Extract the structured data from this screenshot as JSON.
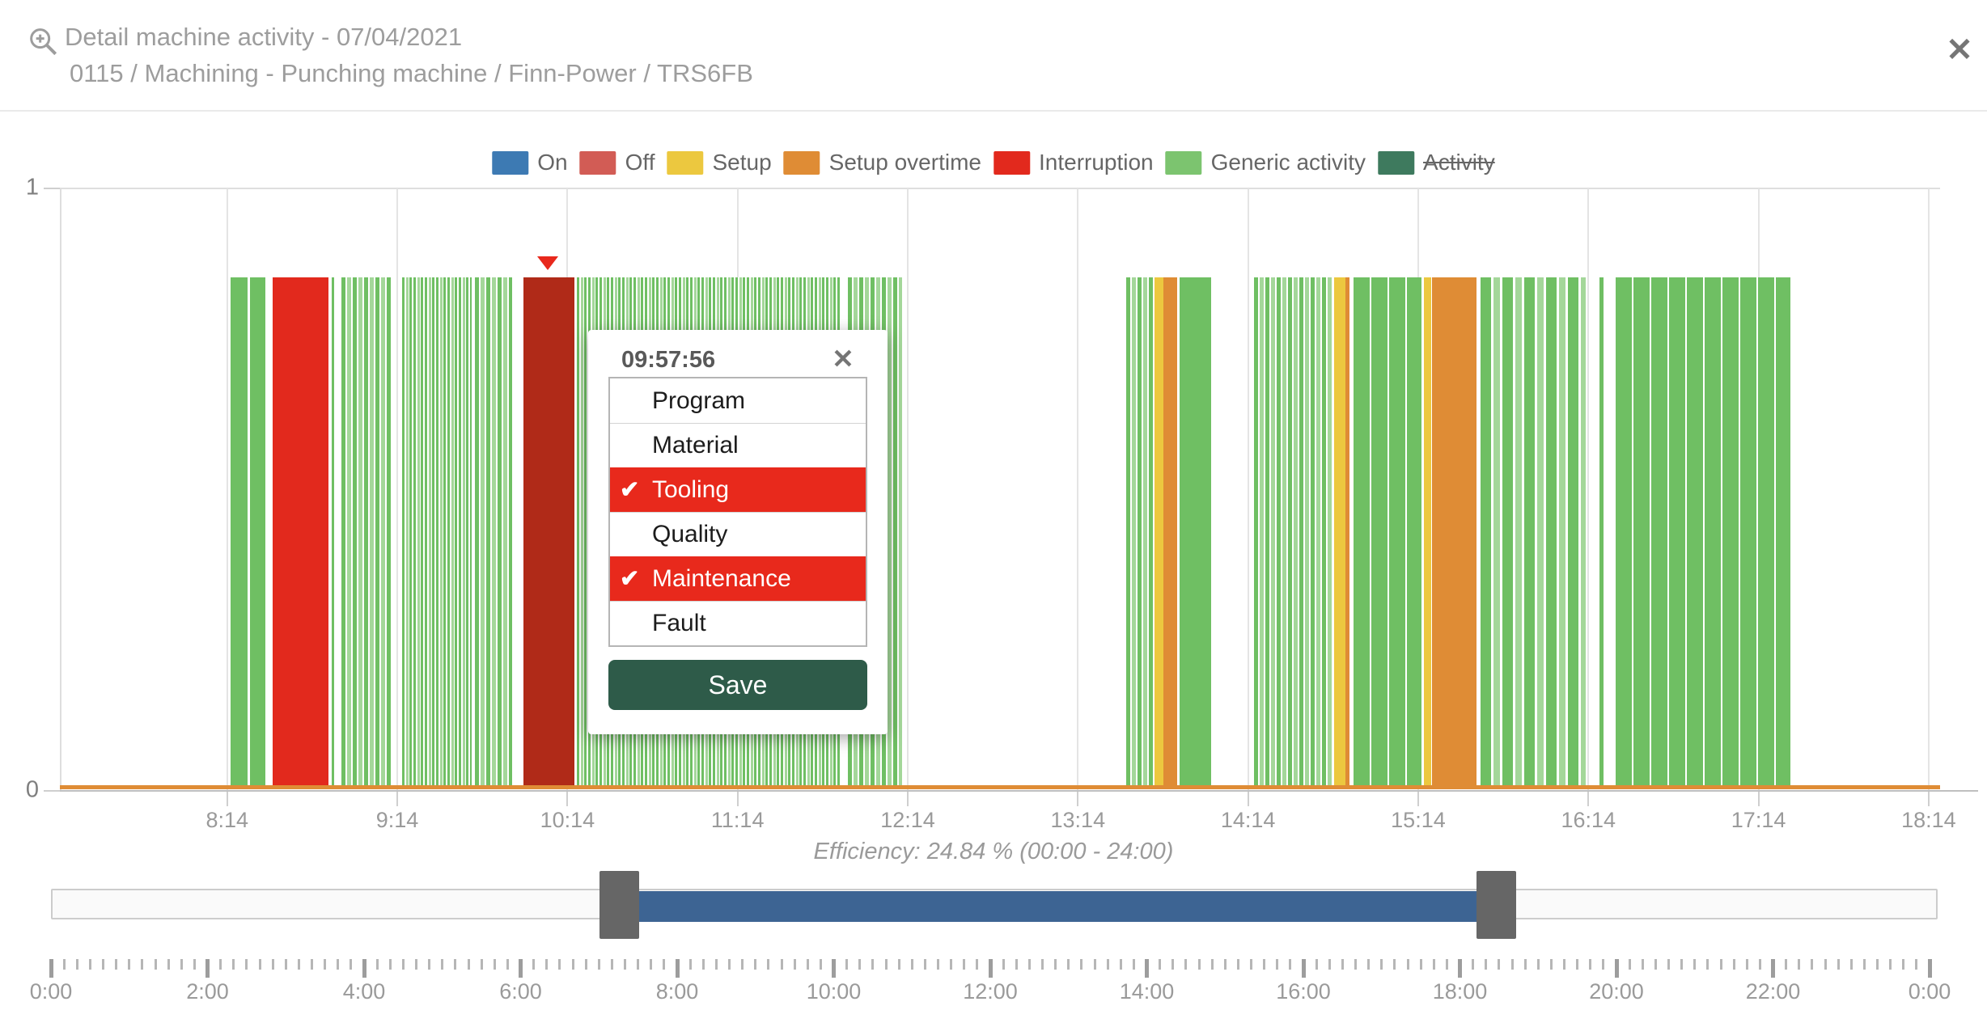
{
  "header": {
    "title": "Detail machine activity - 07/04/2021",
    "subtitle": "0115 / Machining - Punching machine / Finn-Power / TRS6FB"
  },
  "close_button": "✕",
  "legend": [
    {
      "label": "On",
      "color": "#3d7ab3",
      "struck": false
    },
    {
      "label": "Off",
      "color": "#d25c55",
      "struck": false
    },
    {
      "label": "Setup",
      "color": "#ecc83f",
      "struck": false
    },
    {
      "label": "Setup overtime",
      "color": "#df8c35",
      "struck": false
    },
    {
      "label": "Interruption",
      "color": "#e2291d",
      "struck": false
    },
    {
      "label": "Generic activity",
      "color": "#7cc46f",
      "struck": false
    },
    {
      "label": "Activity",
      "color": "#3e7a5e",
      "struck": true
    }
  ],
  "colors": {
    "generic": "#6fbf63",
    "generic_light": "#a4d79a",
    "setup": "#ecc83f",
    "setup_overtime": "#df8c35",
    "interruption": "#e2291d",
    "interruption_classified": "#b02a18",
    "marker": "#e8281c",
    "selected_item": "#e8291c",
    "save_button": "#2e5b49",
    "slider_range": "#3d6493",
    "slider_handle": "#666666"
  },
  "chart_data": {
    "type": "bar",
    "title": "Machine activity timeline 07/04/2021",
    "y_axis": {
      "min": 0,
      "max": 1,
      "tick_labels": [
        "1",
        "0"
      ]
    },
    "x_axis": {
      "start_h": 7.25,
      "end_h": 18.3,
      "ticks": [
        {
          "h": 8.233,
          "label": "8:14"
        },
        {
          "h": 9.233,
          "label": "9:14"
        },
        {
          "h": 10.233,
          "label": "10:14"
        },
        {
          "h": 11.233,
          "label": "11:14"
        },
        {
          "h": 12.233,
          "label": "12:14"
        },
        {
          "h": 13.233,
          "label": "13:14"
        },
        {
          "h": 14.233,
          "label": "14:14"
        },
        {
          "h": 15.233,
          "label": "15:14"
        },
        {
          "h": 16.233,
          "label": "16:14"
        },
        {
          "h": 17.233,
          "label": "17:14"
        },
        {
          "h": 18.233,
          "label": "18:14"
        }
      ]
    },
    "bar_top_value": 0.852,
    "marker_h": 10.117,
    "baseline_strip": {
      "status": "setup_overtime",
      "start": 7.25,
      "end": 18.3
    },
    "segments": [
      {
        "start": 8.253,
        "end": 8.355,
        "status": "generic",
        "pattern": "solid"
      },
      {
        "start": 8.365,
        "end": 8.458,
        "status": "generic",
        "pattern": "solid"
      },
      {
        "start": 8.5,
        "end": 8.829,
        "status": "interruption",
        "pattern": "solid"
      },
      {
        "start": 8.848,
        "end": 8.862,
        "status": "generic",
        "pattern": "solid"
      },
      {
        "start": 8.905,
        "end": 9.195,
        "status": "generic",
        "pattern": "striped"
      },
      {
        "start": 9.261,
        "end": 9.67,
        "status": "generic",
        "pattern": "striped_dense"
      },
      {
        "start": 9.689,
        "end": 9.908,
        "status": "generic",
        "pattern": "striped"
      },
      {
        "start": 9.974,
        "end": 10.274,
        "status": "interruption_classified",
        "pattern": "solid"
      },
      {
        "start": 10.288,
        "end": 11.843,
        "status": "generic",
        "pattern": "striped_dense"
      },
      {
        "start": 11.881,
        "end": 12.2,
        "status": "generic",
        "pattern": "striped"
      },
      {
        "start": 13.517,
        "end": 13.683,
        "status": "generic",
        "pattern": "striped"
      },
      {
        "start": 13.683,
        "end": 13.736,
        "status": "setup",
        "pattern": "solid"
      },
      {
        "start": 13.736,
        "end": 13.816,
        "status": "setup_overtime",
        "pattern": "solid"
      },
      {
        "start": 13.831,
        "end": 14.016,
        "status": "generic",
        "pattern": "solid"
      },
      {
        "start": 14.268,
        "end": 14.734,
        "status": "generic",
        "pattern": "striped"
      },
      {
        "start": 14.739,
        "end": 14.805,
        "status": "setup",
        "pattern": "solid"
      },
      {
        "start": 14.805,
        "end": 14.829,
        "status": "setup_overtime",
        "pattern": "solid"
      },
      {
        "start": 14.853,
        "end": 15.252,
        "status": "generic",
        "pattern": "blocks"
      },
      {
        "start": 15.266,
        "end": 15.309,
        "status": "setup",
        "pattern": "solid"
      },
      {
        "start": 15.314,
        "end": 15.575,
        "status": "setup_overtime",
        "pattern": "solid"
      },
      {
        "start": 15.599,
        "end": 16.217,
        "status": "generic",
        "pattern": "striped_wide"
      },
      {
        "start": 16.298,
        "end": 16.326,
        "status": "generic",
        "pattern": "striped"
      },
      {
        "start": 16.393,
        "end": 17.42,
        "status": "generic",
        "pattern": "blocks"
      }
    ]
  },
  "popup": {
    "time": "09:57:56",
    "close": "✕",
    "check": "✔",
    "items": [
      {
        "label": "Program",
        "selected": false
      },
      {
        "label": "Material",
        "selected": false
      },
      {
        "label": "Tooling",
        "selected": true
      },
      {
        "label": "Quality",
        "selected": false
      },
      {
        "label": "Maintenance",
        "selected": true
      },
      {
        "label": "Fault",
        "selected": false
      }
    ],
    "save_label": "Save"
  },
  "efficiency_label": "Efficiency: 24.84 % (00:00 - 24:00)",
  "slider": {
    "domain_h": [
      0,
      24
    ],
    "start_h": 7.51,
    "end_h": 18.21
  },
  "bottom_axis": {
    "major_step_h": 2,
    "minor_step_min": 10,
    "labels": [
      "0:00",
      "2:00",
      "4:00",
      "6:00",
      "8:00",
      "10:00",
      "12:00",
      "14:00",
      "16:00",
      "18:00",
      "20:00",
      "22:00",
      "0:00"
    ]
  }
}
